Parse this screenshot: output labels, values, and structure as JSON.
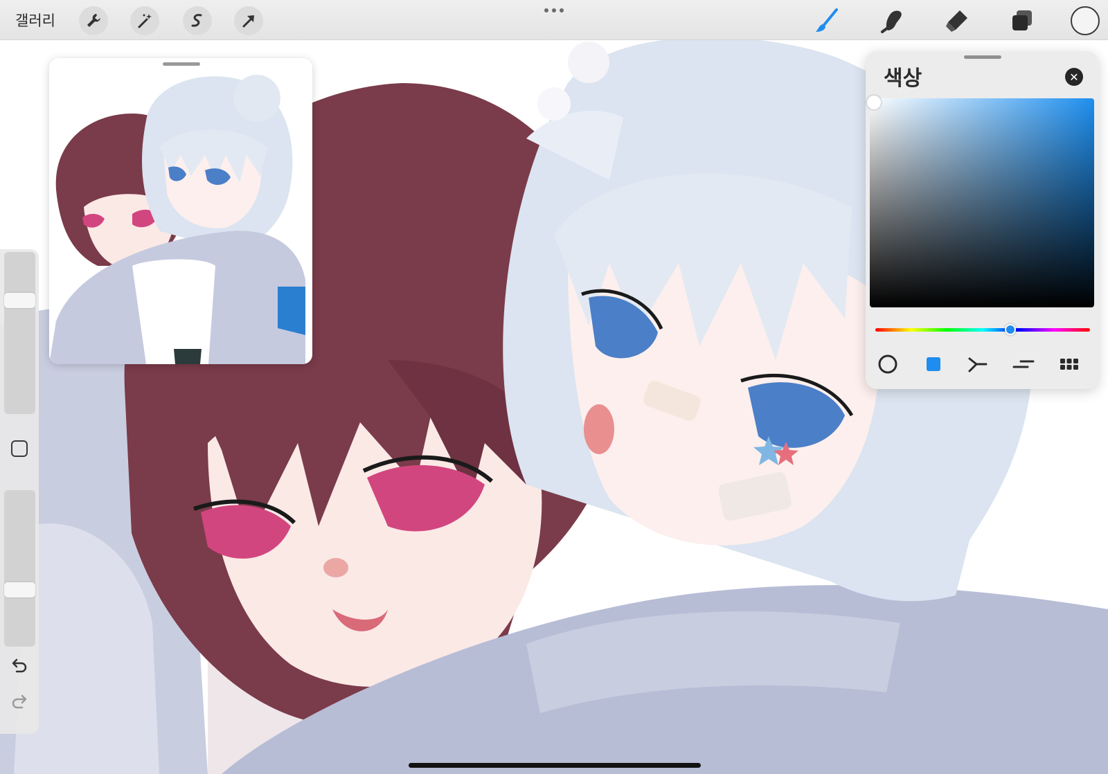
{
  "toolbar": {
    "gallery_label": "갤러리",
    "left_tools": [
      "wrench-icon",
      "magic-wand-icon",
      "selection-icon",
      "transform-arrow-icon"
    ],
    "right_tools": [
      "brush-icon",
      "smudge-icon",
      "eraser-icon",
      "layers-icon"
    ],
    "active_tool": "brush-icon",
    "active_color": "#1f8cf0",
    "current_color": "#f4f4f4"
  },
  "color_panel": {
    "title": "색상",
    "hue_level": 0.63,
    "modes": [
      "disc-icon",
      "classic-icon",
      "harmony-icon",
      "value-icon",
      "palettes-icon"
    ],
    "active_mode": "classic-icon",
    "accent": "#1f8cf0"
  },
  "sidebar": {
    "brush_size_level": 0.72,
    "opacity_level": 0.35
  }
}
